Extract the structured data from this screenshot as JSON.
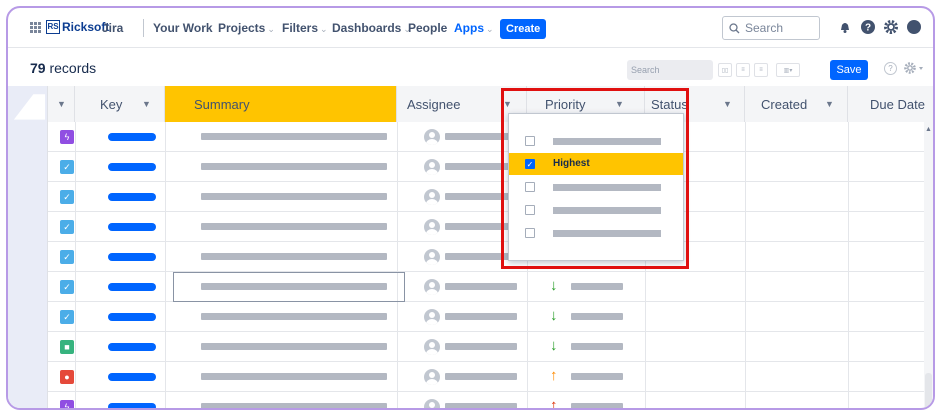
{
  "nav": {
    "logo_mark": "RS",
    "logo_text": "Ricksoft",
    "items": [
      "Jira",
      "Your Work",
      "Projects",
      "Filters",
      "Dashboards",
      "People",
      "Apps"
    ],
    "create_label": "Create",
    "search_placeholder": "Search"
  },
  "toolbar": {
    "record_count": "79",
    "record_label": "records",
    "search_placeholder": "Search",
    "save_label": "Save",
    "help_label": "?"
  },
  "columns": [
    "Key",
    "Summary",
    "Assignee",
    "Priority",
    "Status",
    "Created",
    "Due Date"
  ],
  "rows": [
    {
      "type": "epic",
      "type_color": "#904ee2",
      "glyph": "ϟ",
      "priority": "none"
    },
    {
      "type": "task",
      "type_color": "#4bade8",
      "glyph": "✓",
      "priority": "none"
    },
    {
      "type": "task",
      "type_color": "#4bade8",
      "glyph": "✓",
      "priority": "none"
    },
    {
      "type": "task",
      "type_color": "#4bade8",
      "glyph": "✓",
      "priority": "none"
    },
    {
      "type": "task",
      "type_color": "#4bade8",
      "glyph": "✓",
      "priority": "low"
    },
    {
      "type": "task",
      "type_color": "#4bade8",
      "glyph": "✓",
      "priority": "low"
    },
    {
      "type": "task",
      "type_color": "#4bade8",
      "glyph": "✓",
      "priority": "low"
    },
    {
      "type": "story",
      "type_color": "#36b37e",
      "glyph": "■",
      "priority": "low"
    },
    {
      "type": "bug",
      "type_color": "#e5493a",
      "glyph": "●",
      "priority": "high"
    },
    {
      "type": "epic",
      "type_color": "#904ee2",
      "glyph": "ϟ",
      "priority": "highest"
    }
  ],
  "priority_colors": {
    "low": "#2a9d2a",
    "high": "#ff8b00",
    "highest": "#de350b"
  },
  "priority_filter": {
    "options": [
      {
        "label": "",
        "checked": false
      },
      {
        "label": "Highest",
        "checked": true
      },
      {
        "label": "",
        "checked": false
      },
      {
        "label": "",
        "checked": false
      },
      {
        "label": "",
        "checked": false
      }
    ]
  }
}
